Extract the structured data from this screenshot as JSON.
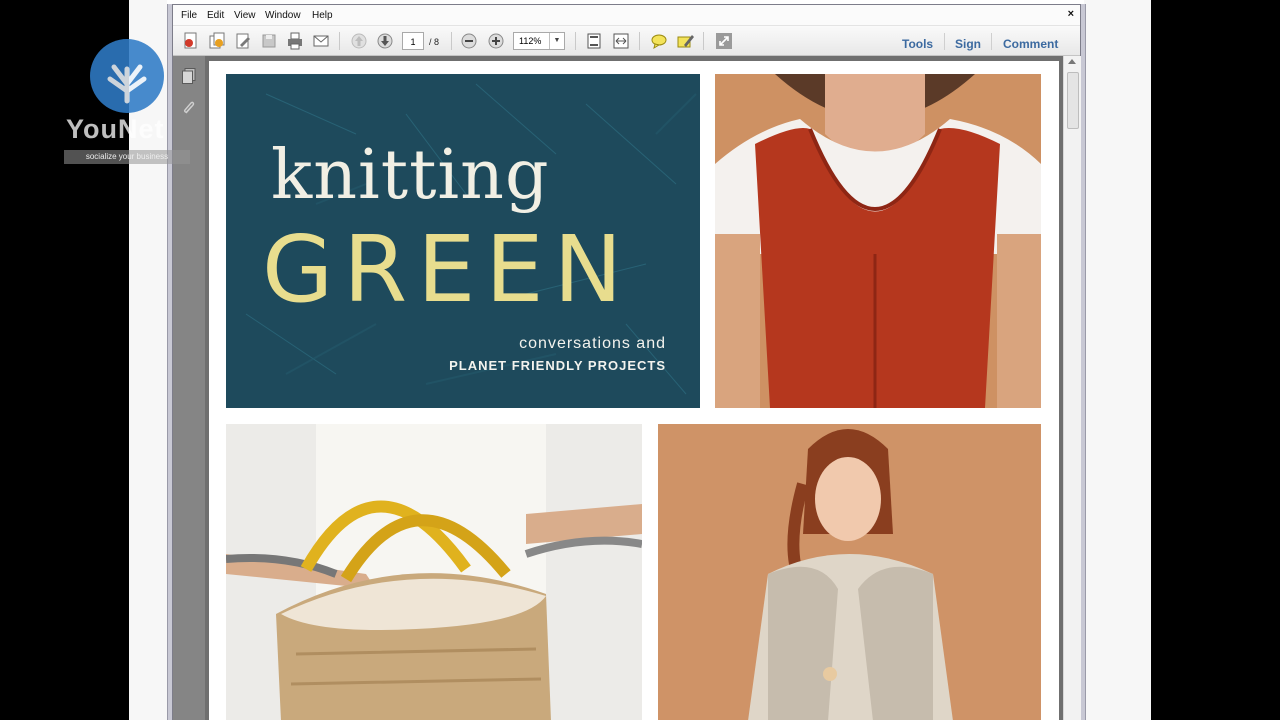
{
  "menu": {
    "items": [
      "File",
      "Edit",
      "View",
      "Window",
      "Help"
    ],
    "close_label": "×"
  },
  "toolbar": {
    "page_current": "1",
    "page_total": "/ 8",
    "zoom": "112%",
    "zoom_dropdown": "▼",
    "right_links": [
      "Tools",
      "Sign",
      "Comment"
    ]
  },
  "document": {
    "cover_script_title": "knitting",
    "cover_big_title": "GREEN",
    "cover_subtitle_1": "conversations and",
    "cover_subtitle_2": "PLANET FRIENDLY PROJECTS"
  },
  "watermark": {
    "name": "YouNet",
    "tagline": "socialize your business"
  },
  "colors": {
    "link_blue": "#3c6aa0",
    "cover_bg": "#1e4a5c",
    "cover_accent": "#e8dd8e"
  }
}
